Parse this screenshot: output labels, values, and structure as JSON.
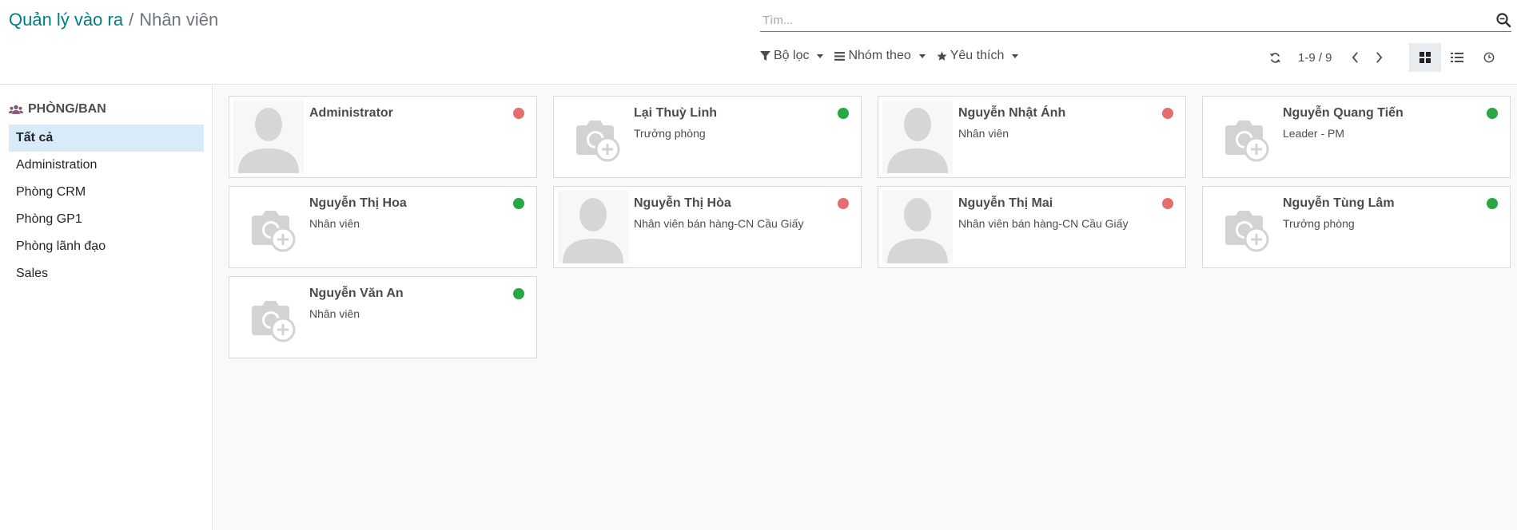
{
  "breadcrumb": {
    "parent": "Quản lý vào ra",
    "separator": "/",
    "current": "Nhân viên"
  },
  "search": {
    "placeholder": "Tìm..."
  },
  "filters": {
    "filter_label": "Bộ lọc",
    "groupby_label": "Nhóm theo",
    "favorites_label": "Yêu thích"
  },
  "pager": {
    "value": "1-9 / 9"
  },
  "sidebar": {
    "header": "PHÒNG/BAN",
    "items": [
      {
        "label": "Tất cả"
      },
      {
        "label": "Administration"
      },
      {
        "label": "Phòng CRM"
      },
      {
        "label": "Phòng GP1"
      },
      {
        "label": "Phòng lãnh đạo"
      },
      {
        "label": "Sales"
      }
    ],
    "active_index": 0
  },
  "colors": {
    "status_online": "#28a745",
    "status_offline": "#e66d6d",
    "accent": "#017e84"
  },
  "employees": [
    {
      "name": "Administrator",
      "job": "",
      "avatar": "person-placeholder",
      "status": "offline"
    },
    {
      "name": "Lại Thuỳ Linh",
      "job": "Trưởng phòng",
      "avatar": "camera-plus-placeholder",
      "status": "online"
    },
    {
      "name": "Nguyễn Nhật Ánh",
      "job": "Nhân viên",
      "avatar": "person-placeholder",
      "status": "offline"
    },
    {
      "name": "Nguyễn Quang Tiến",
      "job": "Leader - PM",
      "avatar": "camera-plus-placeholder",
      "status": "online"
    },
    {
      "name": "Nguyễn Thị Hoa",
      "job": "Nhân viên",
      "avatar": "camera-plus-placeholder",
      "status": "online"
    },
    {
      "name": "Nguyễn Thị Hòa",
      "job": "Nhân viên bán hàng-CN Cầu Giấy",
      "avatar": "person-placeholder",
      "status": "offline"
    },
    {
      "name": "Nguyễn Thị Mai",
      "job": "Nhân viên bán hàng-CN Cầu Giấy",
      "avatar": "person-placeholder",
      "status": "offline"
    },
    {
      "name": "Nguyễn Tùng Lâm",
      "job": "Trưởng phòng",
      "avatar": "camera-plus-placeholder",
      "status": "online"
    },
    {
      "name": "Nguyễn Văn An",
      "job": "Nhân viên",
      "avatar": "camera-plus-placeholder",
      "status": "online"
    }
  ]
}
